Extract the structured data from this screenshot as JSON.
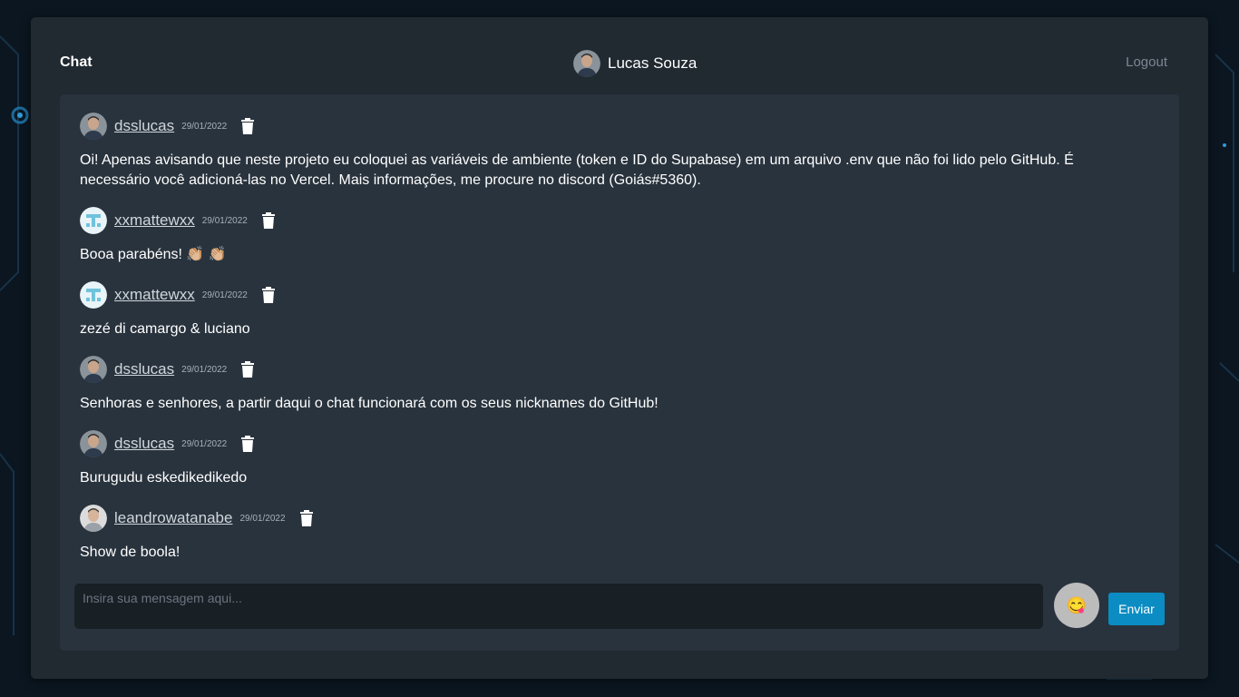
{
  "header": {
    "title": "Chat",
    "user_name": "Lucas Souza",
    "logout_label": "Logout"
  },
  "messages": [
    {
      "user": "dsslucas",
      "date": "29/01/2022",
      "avatar": "photo-man",
      "text": "Oi! Apenas avisando que neste projeto eu coloquei as variáveis de ambiente (token e ID do Supabase) em um arquivo .env que não foi lido pelo GitHub. É necessário você adicioná-las no Vercel. Mais informações, me procure no discord (Goiás#5360)."
    },
    {
      "user": "xxmattewxx",
      "date": "29/01/2022",
      "avatar": "identicon-t",
      "text": "Booa parabéns! 👏🏼 👏🏼"
    },
    {
      "user": "xxmattewxx",
      "date": "29/01/2022",
      "avatar": "identicon-t",
      "text": "zezé di camargo & luciano"
    },
    {
      "user": "dsslucas",
      "date": "29/01/2022",
      "avatar": "photo-man",
      "text": "Senhoras e senhores, a partir daqui o chat funcionará com os seus nicknames do GitHub!"
    },
    {
      "user": "dsslucas",
      "date": "29/01/2022",
      "avatar": "photo-man",
      "text": "Burugudu eskedikedikedo"
    },
    {
      "user": "leandrowatanabe",
      "date": "29/01/2022",
      "avatar": "photo-man-light",
      "text": "Show de boola!"
    }
  ],
  "composer": {
    "placeholder": "Insira sua mensagem aqui...",
    "value": ""
  },
  "emoji_button": {
    "icon": "emoji-icon",
    "glyph": "😋"
  },
  "send_label": "Enviar",
  "colors": {
    "panel": "#212931",
    "chat_area": "#29333d",
    "send_button": "#0b8cc2",
    "composer": "#181f25"
  }
}
